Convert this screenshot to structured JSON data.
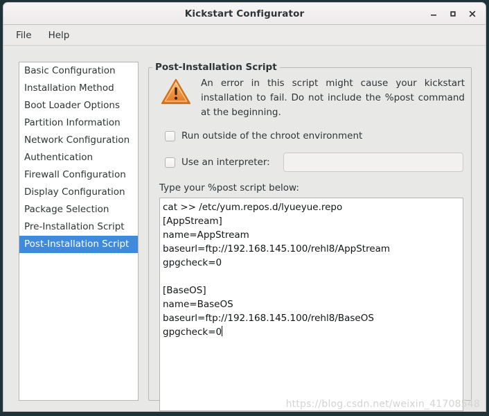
{
  "window": {
    "title": "Kickstart Configurator",
    "controls": [
      {
        "name": "minimize",
        "glyph": "minimize-icon"
      },
      {
        "name": "maximize",
        "glyph": "maximize-icon"
      },
      {
        "name": "close",
        "glyph": "close-icon"
      }
    ]
  },
  "menubar": {
    "items": [
      {
        "label": "File"
      },
      {
        "label": "Help"
      }
    ]
  },
  "sidebar": {
    "items": [
      {
        "label": "Basic Configuration",
        "selected": false
      },
      {
        "label": "Installation Method",
        "selected": false
      },
      {
        "label": "Boot Loader Options",
        "selected": false
      },
      {
        "label": "Partition Information",
        "selected": false
      },
      {
        "label": "Network Configuration",
        "selected": false
      },
      {
        "label": "Authentication",
        "selected": false
      },
      {
        "label": "Firewall Configuration",
        "selected": false
      },
      {
        "label": "Display Configuration",
        "selected": false
      },
      {
        "label": "Package Selection",
        "selected": false
      },
      {
        "label": "Pre-Installation Script",
        "selected": false
      },
      {
        "label": "Post-Installation Script",
        "selected": true
      }
    ],
    "selected_label": "Post-Installation Script",
    "selection_color": "#3f8ada"
  },
  "panel": {
    "group_title": "Post-Installation Script",
    "warning": {
      "icon": "warning-triangle-icon",
      "icon_color": "#f0883e",
      "text": "An error in this script might cause your kickstart installation to fail. Do not include the %post command at the beginning."
    },
    "chroot_checkbox": {
      "label": "Run outside of the chroot environment",
      "checked": false
    },
    "interpreter_checkbox": {
      "label": "Use an interpreter:",
      "checked": false
    },
    "interpreter_input": {
      "value": "",
      "placeholder": "",
      "enabled": false
    },
    "script_label": "Type your %post script below:",
    "script_text": "cat >> /etc/yum.repos.d/lyueyue.repo\n[AppStream]\nname=AppStream\nbaseurl=ftp://192.168.145.100/rehl8/AppStream\ngpgcheck=0\n\n[BaseOS]\nname=BaseOS\nbaseurl=ftp://192.168.145.100/rehl8/BaseOS\ngpgcheck=0"
  },
  "watermark": {
    "text": "https://blog.csdn.net/weixin_41708548"
  }
}
